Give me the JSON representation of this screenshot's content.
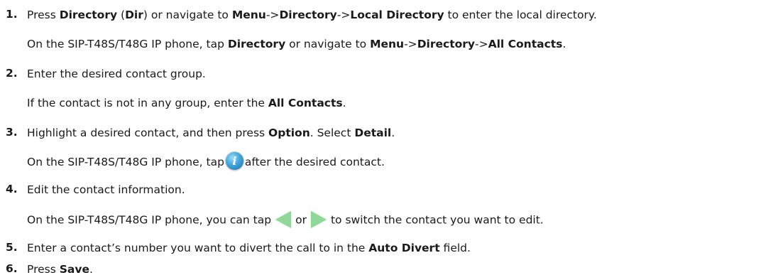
{
  "steps": [
    {
      "num": "1.",
      "line1": {
        "t1": "Press ",
        "b1": "Directory",
        "t2": " (",
        "b2": "Dir",
        "t3": ") or navigate to ",
        "b3": "Menu",
        "t4": "->",
        "b4": "Directory",
        "t5": "->",
        "b5": "Local Directory",
        "t6": " to enter the local directory."
      },
      "line2": {
        "t1": "On the SIP-T48S/T48G IP phone, tap ",
        "b1": "Directory",
        "t2": " or navigate to ",
        "b2": "Menu",
        "t3": "->",
        "b3": "Directory",
        "t4": "->",
        "b4": "All Contacts",
        "t5": "."
      }
    },
    {
      "num": "2.",
      "line1": {
        "t1": "Enter the desired contact group."
      },
      "line2": {
        "t1": "If the contact is not in any group, enter the ",
        "b1": "All Contacts",
        "t2": "."
      }
    },
    {
      "num": "3.",
      "line1": {
        "t1": "Highlight a desired contact, and then press ",
        "b1": "Option",
        "t2": ". Select ",
        "b2": "Detail",
        "t3": "."
      },
      "line2": {
        "t1": "On the SIP-T48S/T48G IP phone, tap",
        "icon": "info-icon",
        "t2": "after the desired contact."
      }
    },
    {
      "num": "4.",
      "line1": {
        "t1": "Edit the contact information."
      },
      "line2": {
        "t1": "On the SIP-T48S/T48G IP phone, you can tap",
        "icon1": "left-arrow-icon",
        "t2": "or",
        "icon2": "right-arrow-icon",
        "t3": "to switch the contact you want to edit."
      }
    },
    {
      "num": "5.",
      "line1": {
        "t1": "Enter a contact’s number you want to divert the call to in the ",
        "b1": "Auto Divert",
        "t2": " field."
      }
    },
    {
      "num": "6.",
      "line1": {
        "t1": "Press ",
        "b1": "Save",
        "t2": "."
      }
    }
  ],
  "colors": {
    "text": "#1a1a1a",
    "icon_blue": "#3fa6dc",
    "arrow_green": "#8fd89a"
  }
}
